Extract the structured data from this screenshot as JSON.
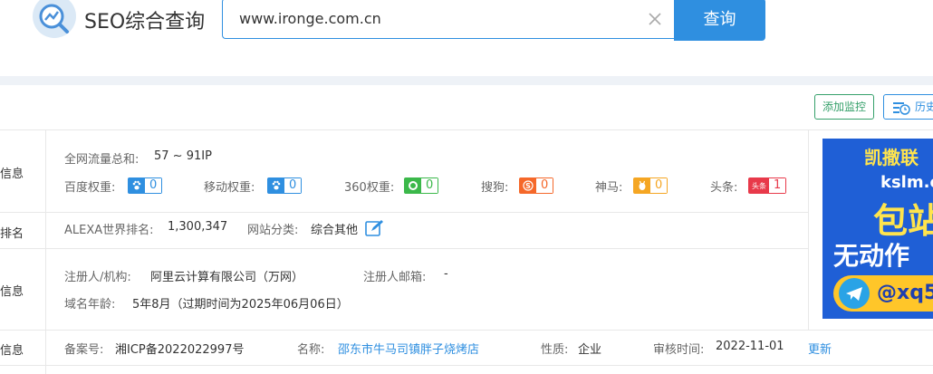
{
  "header": {
    "logo_text": "SEO综合查询",
    "search_value": "www.ironge.com.cn",
    "search_button": "查询"
  },
  "toolbar": {
    "add_monitor": "添加监控",
    "history": "历史"
  },
  "rows": {
    "r1": {
      "label": "信息",
      "traffic_label": "全网流量总和:",
      "traffic_value": "57 ~ 91IP",
      "weights": [
        {
          "name": "百度权重:",
          "value": "0",
          "icon": "baidu-paw-icon",
          "color": "#2f8fe0"
        },
        {
          "name": "移动权重:",
          "value": "0",
          "icon": "baidu-paw-icon",
          "color": "#2f8fe0"
        },
        {
          "name": "360权重:",
          "value": "0",
          "icon": "360-icon",
          "color": "#3bb84a"
        },
        {
          "name": "搜狗:",
          "value": "0",
          "icon": "sogou-icon",
          "color": "#f5682a"
        },
        {
          "name": "神马:",
          "value": "0",
          "icon": "shenma-icon",
          "color": "#f5a623"
        },
        {
          "name": "头条:",
          "value": "1",
          "icon": "toutiao-icon",
          "color": "#e8394a",
          "icon_text": "头条"
        }
      ]
    },
    "r2": {
      "label": "排名",
      "alexa_label": "ALEXA世界排名:",
      "alexa_value": "1,300,347",
      "category_label": "网站分类:",
      "category_value": "综合其他"
    },
    "r3": {
      "label": "信息",
      "registrant_label": "注册人/机构:",
      "registrant_value": "阿里云计算有限公司（万网）",
      "email_label": "注册人邮箱:",
      "email_value": "-",
      "age_label": "域名年龄:",
      "age_value": "5年8月（过期时间为2025年06月06日）"
    },
    "r4": {
      "label": "信息",
      "icp_label": "备案号:",
      "icp_value": "湘ICP备2022022997号",
      "name_label": "名称:",
      "name_value": "邵东市牛马司镇胖子烧烤店",
      "nature_label": "性质:",
      "nature_value": "企业",
      "audit_label": "审核时间:",
      "audit_value": "2022-11-01",
      "update_link": "更新"
    }
  },
  "ad": {
    "line1": "凯撒联",
    "line2": "kslm.c",
    "line3": "包站",
    "line4": "无动作",
    "line5": "@xq5"
  }
}
